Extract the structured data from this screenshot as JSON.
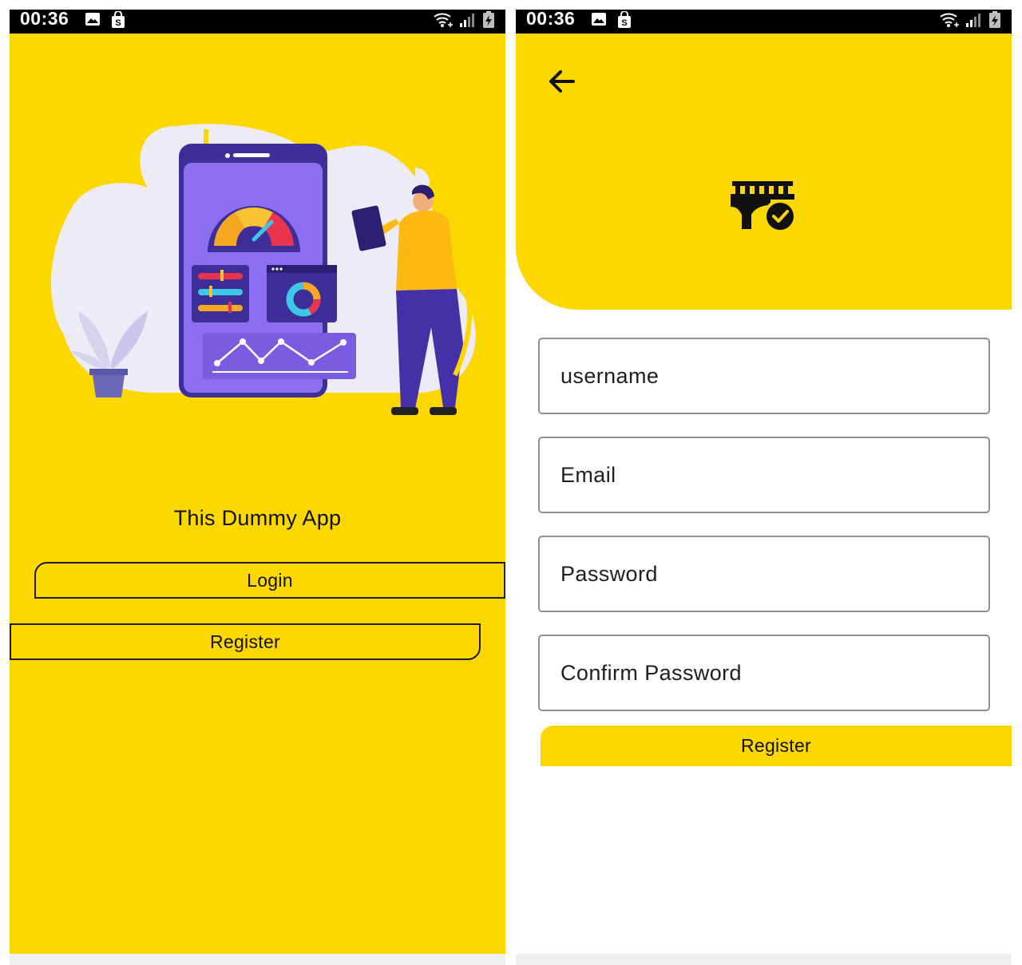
{
  "status_bar": {
    "time": "00:36"
  },
  "welcome_screen": {
    "app_title": "This Dummy App",
    "login_label": "Login",
    "register_label": "Register"
  },
  "register_screen": {
    "fields": {
      "username_placeholder": "username",
      "email_placeholder": "Email",
      "password_placeholder": "Password",
      "confirm_password_placeholder": "Confirm Password"
    },
    "register_label": "Register"
  },
  "icons": {
    "status": [
      "gallery-icon",
      "shopping-bag-icon",
      "wifi-icon",
      "signal-icon",
      "battery-icon"
    ],
    "back": "arrow-left-icon",
    "logo": "railway-check-icon"
  },
  "colors": {
    "accent": "#FCD700",
    "status_bar": "#000000",
    "text": "#111111",
    "field_border": "#8f8f8f"
  }
}
